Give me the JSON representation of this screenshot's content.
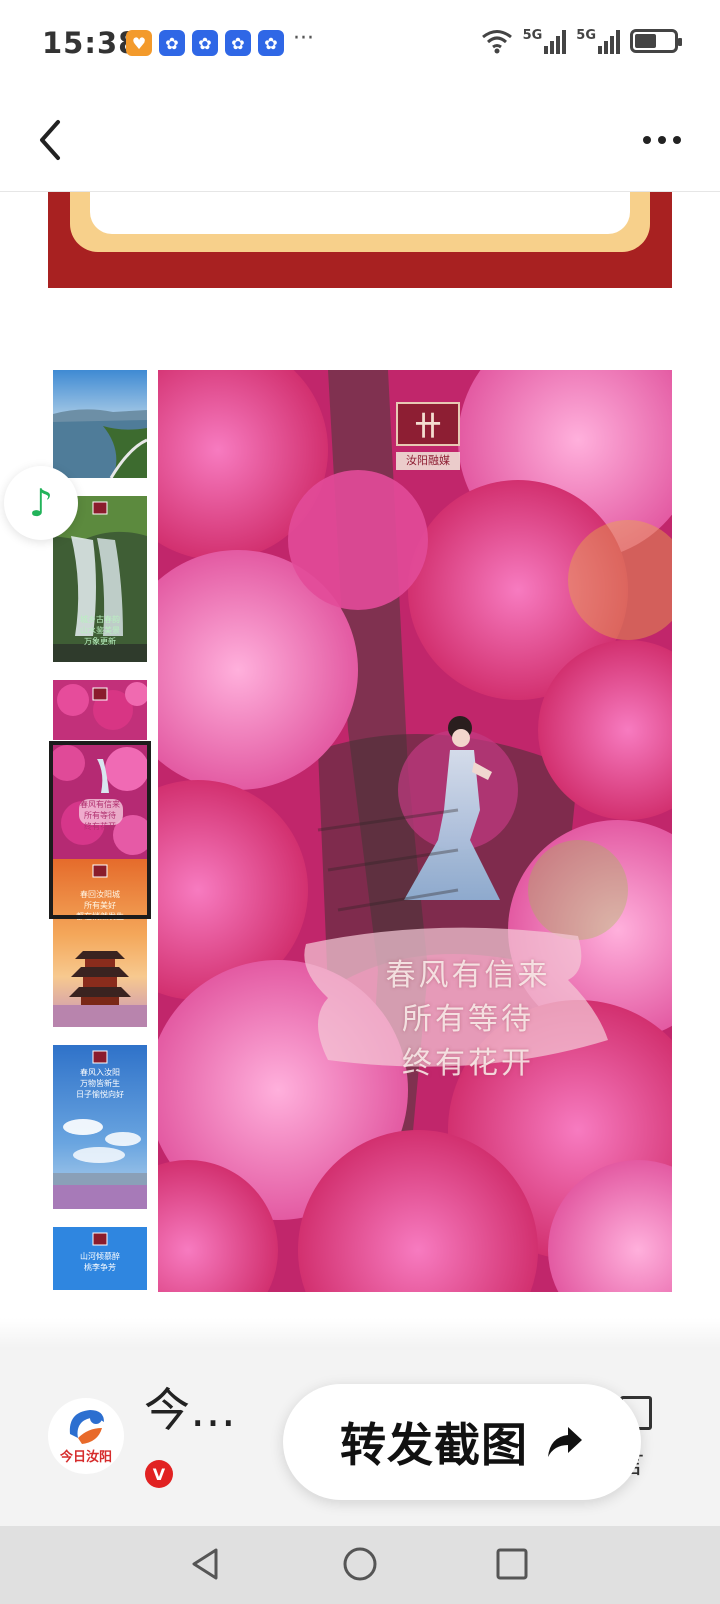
{
  "status_bar": {
    "time": "15:38",
    "more": "···",
    "network_1": "5G",
    "network_2": "5G"
  },
  "nav": {
    "back": "back",
    "more": "more-options"
  },
  "content": {
    "main_logo_caption": "汝阳融媒",
    "main_logo_mark": "卄",
    "poem": [
      "春风有信来",
      "所有等待",
      "终有花开"
    ],
    "thumbnails": [
      {
        "caption": ""
      },
      {
        "caption": "城乡古春韵\n山水鉴美景\n万象更新"
      },
      {
        "caption": "春风有信来\n所有等待\n终有花开"
      },
      {
        "caption": "春回汝阳城\n所有美好\n都在悄然发生"
      },
      {
        "caption": "春风入汝阳\n万物皆新生\n日子愉悦向好"
      },
      {
        "caption": "山河倾慕醉\n桃李争芳"
      }
    ]
  },
  "bottom": {
    "account_name": "今…",
    "avatar_label": "今日汝阳",
    "vip_badge": "V",
    "side_action_label": "言",
    "share_button": "转发截图"
  },
  "colors": {
    "banner_red": "#a82121",
    "banner_gold": "#f7d08b",
    "music_green": "#22b35a",
    "vip_red": "#e12222",
    "app_icon_blue": "#2f67e6",
    "app_icon_orange": "#f39a2b"
  },
  "icons": {
    "music": "music-note-icon",
    "share": "share-arrow-icon",
    "back": "chevron-left-icon",
    "wifi": "wifi-icon",
    "battery": "battery-icon"
  }
}
